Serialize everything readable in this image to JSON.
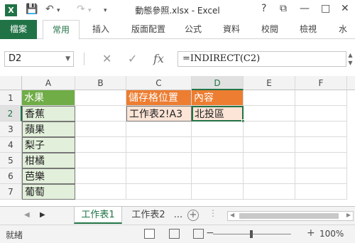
{
  "window": {
    "app_icon": "X",
    "title": "動態參照.xlsx - Excel",
    "help": "?",
    "restore": "⧉",
    "minimize": "—",
    "maximize": "□",
    "close": "✕"
  },
  "quick_access": {
    "save": "💾",
    "undo": "↶",
    "redo": "↷",
    "more": "▾"
  },
  "ribbon": {
    "file_tab": "檔案",
    "tabs": [
      "常用",
      "插入",
      "版面配置",
      "公式",
      "資料",
      "校閱",
      "檢視",
      "水"
    ],
    "active_tab_index": 0
  },
  "formula_bar": {
    "name_box": "D2",
    "formula": "=INDIRECT(C2)",
    "cancel_icon": "✕",
    "enter_icon": "✓",
    "fx_label": "fx"
  },
  "grid": {
    "columns": [
      "A",
      "B",
      "C",
      "D",
      "E",
      "F"
    ],
    "selected_column": "D",
    "rows": [
      "1",
      "2",
      "3",
      "4",
      "5",
      "6",
      "7"
    ],
    "selected_row": "2",
    "cells": {
      "A1": "水果",
      "A2": "香蕉",
      "A3": "蘋果",
      "A4": "梨子",
      "A5": "柑橘",
      "A6": "芭樂",
      "A7": "葡萄",
      "C1": "儲存格位置",
      "D1": "內容",
      "C2": "工作表2!A3",
      "D2": "北投區"
    },
    "colors": {
      "header_green": "#70ad47",
      "header_orange": "#ed7d31",
      "fill_green": "#e2efda",
      "fill_orange": "#fce4d6",
      "accent": "#217346"
    }
  },
  "sheets": {
    "tabs": [
      "工作表1",
      "工作表2"
    ],
    "active_index": 0,
    "add_label": "+",
    "more_label": "..."
  },
  "status": {
    "text": "就緒",
    "zoom": "100%",
    "zoom_minus": "−",
    "zoom_plus": "+"
  }
}
